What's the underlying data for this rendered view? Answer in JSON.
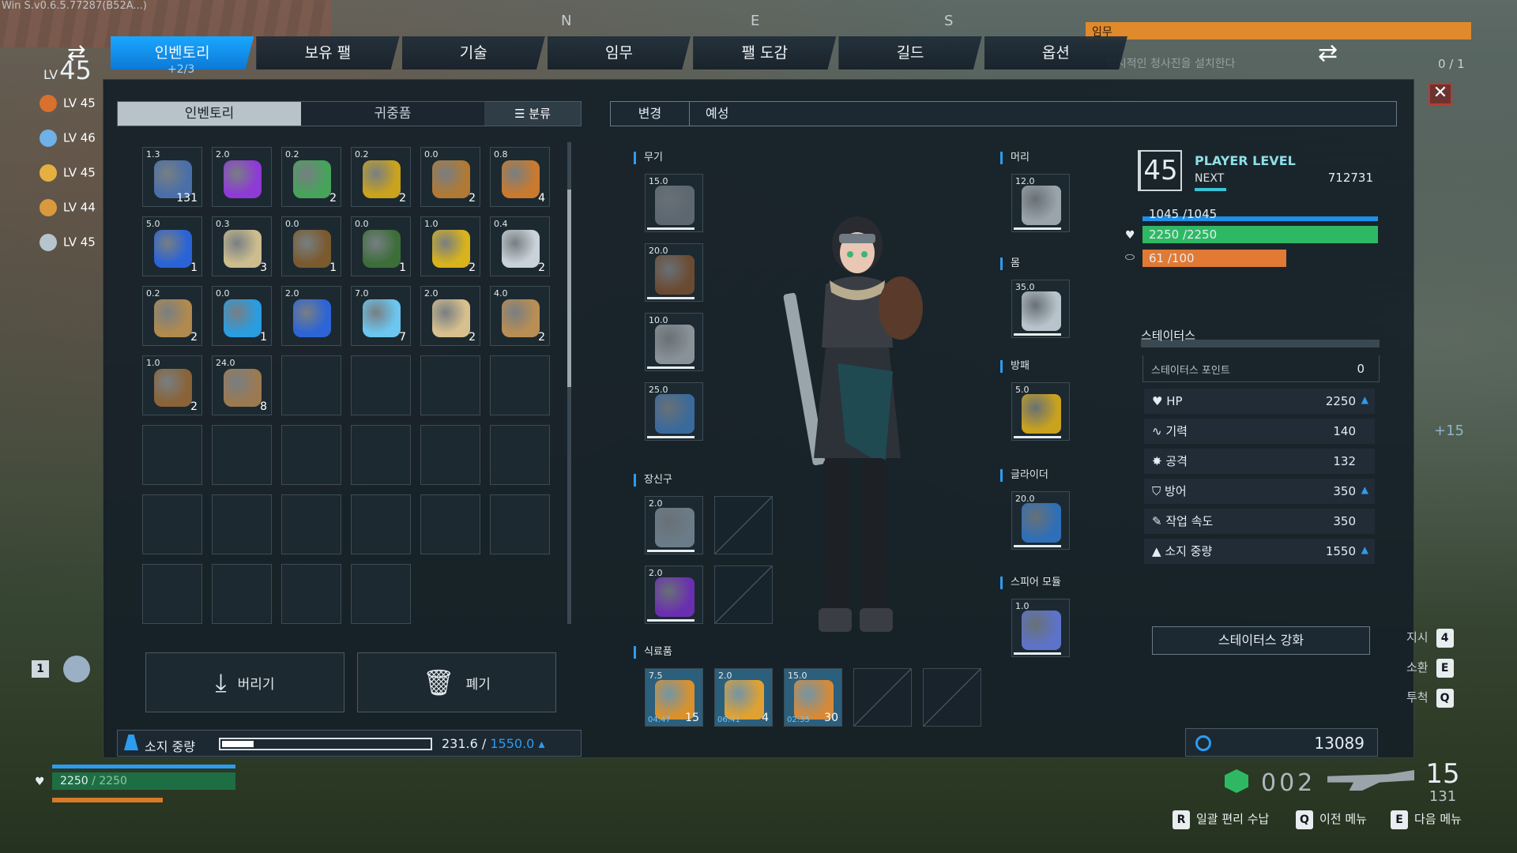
{
  "version_text": "Win S.v0.6.5.77287(B52A...)",
  "compass": [
    "N",
    "E",
    "S"
  ],
  "quest": {
    "label": "임무",
    "text": "임시적인 청사진을 설치한다",
    "count": "0 / 1"
  },
  "player": {
    "lv_prefix": "LV",
    "level": "45",
    "sub": "+2/3"
  },
  "party": [
    {
      "lv": "LV 45",
      "color": "#d9702e"
    },
    {
      "lv": "LV 46",
      "color": "#6fb1e8"
    },
    {
      "lv": "LV 45",
      "color": "#e6b040"
    },
    {
      "lv": "LV 44",
      "color": "#d99a3e"
    },
    {
      "lv": "LV 45",
      "color": "#b6c4ce"
    }
  ],
  "tabs": [
    "인벤토리",
    "보유 팰",
    "기술",
    "임무",
    "팰 도감",
    "길드",
    "옵션"
  ],
  "inventory": {
    "subtabs": [
      "인벤토리",
      "귀중품",
      "분류"
    ],
    "items": [
      {
        "w": "1.3",
        "q": "131",
        "icon": "arrow-bundle",
        "c": "#4a6fa8"
      },
      {
        "w": "2.0",
        "q": "",
        "icon": "whistle",
        "c": "#8e3ad6"
      },
      {
        "w": "0.2",
        "q": "2",
        "icon": "green-sphere",
        "c": "#47a35a"
      },
      {
        "w": "0.2",
        "q": "2",
        "icon": "gold-sphere",
        "c": "#c9a21e"
      },
      {
        "w": "0.0",
        "q": "2",
        "icon": "bullets",
        "c": "#b07a34"
      },
      {
        "w": "0.8",
        "q": "4",
        "icon": "telescope",
        "c": "#c97a2e"
      },
      {
        "w": "5.0",
        "q": "1",
        "icon": "blue-gem",
        "c": "#2a63d6"
      },
      {
        "w": "0.3",
        "q": "3",
        "icon": "scroll-map",
        "c": "#cdbd8e"
      },
      {
        "w": "0.0",
        "q": "1",
        "icon": "schematic",
        "c": "#7a5a2e"
      },
      {
        "w": "0.0",
        "q": "1",
        "icon": "green-book",
        "c": "#3d6e3a"
      },
      {
        "w": "1.0",
        "q": "2",
        "icon": "gold-ore",
        "c": "#d9b31c"
      },
      {
        "w": "0.4",
        "q": "2",
        "icon": "wool",
        "c": "#c9d2d8"
      },
      {
        "w": "0.2",
        "q": "2",
        "icon": "key",
        "c": "#b08a4e"
      },
      {
        "w": "0.0",
        "q": "1",
        "icon": "swirl-gem",
        "c": "#2a9ce0"
      },
      {
        "w": "2.0",
        "q": "",
        "icon": "blue-whistle",
        "c": "#2d64d6"
      },
      {
        "w": "7.0",
        "q": "7",
        "icon": "ice-crystal",
        "c": "#6cc6ee"
      },
      {
        "w": "2.0",
        "q": "2",
        "icon": "bone",
        "c": "#d8c08e"
      },
      {
        "w": "4.0",
        "q": "2",
        "icon": "wood-log",
        "c": "#b98e54"
      },
      {
        "w": "1.0",
        "q": "2",
        "icon": "fiber",
        "c": "#8a6338"
      },
      {
        "w": "24.0",
        "q": "8",
        "icon": "wood-pile",
        "c": "#9b7a52"
      }
    ],
    "empty_slots": 20,
    "drop_label": "버리기",
    "discard_label": "폐기",
    "weight_label": "소지 중량",
    "weight_value": "231.6 / ",
    "weight_max": "1550.0 ▴",
    "weight_ratio": 0.149
  },
  "equip": {
    "tab_change": "변경",
    "tab_preset": "예성",
    "sections": {
      "weapon": "무기",
      "head": "머리",
      "body": "몸",
      "shield": "방패",
      "accessory": "장신구",
      "glider": "글라이더",
      "sphere": "스피어 모듈",
      "food": "식료품"
    },
    "weapons": [
      {
        "w": "15.0",
        "c": "#5c6770"
      },
      {
        "w": "20.0",
        "c": "#6b4a32"
      },
      {
        "w": "10.0",
        "c": "#8a9299"
      },
      {
        "w": "25.0",
        "c": "#3a6a9c"
      }
    ],
    "head": {
      "w": "12.0",
      "c": "#9aa4ab"
    },
    "body": {
      "w": "35.0",
      "c": "#b8c4cc"
    },
    "shield": {
      "w": "5.0",
      "c": "#c9a21e"
    },
    "glider": {
      "w": "20.0",
      "c": "#2e6fb8"
    },
    "sphere": {
      "w": "1.0",
      "c": "#5d73c9"
    },
    "accessories": [
      {
        "w": "2.0",
        "c": "#6b7c88"
      },
      {
        "w": "2.0",
        "c": "#6a2fb0"
      }
    ],
    "food": [
      {
        "w": "7.5",
        "q": "15",
        "t": "04:47",
        "c": "#d9912e"
      },
      {
        "w": "2.0",
        "q": "4",
        "t": "06:41",
        "c": "#e0a132"
      },
      {
        "w": "15.0",
        "q": "30",
        "t": "02:35",
        "c": "#d58a3a"
      }
    ]
  },
  "status": {
    "level": "45",
    "player_level_label": "PLAYER LEVEL",
    "next_label": "NEXT",
    "next_value": "712731",
    "shield_text": "1045 /1045",
    "hp_text": "2250 /2250",
    "stamina_text": "61 /100",
    "stamina_ratio": 0.61,
    "section_title": "스테이터스",
    "points_label": "스테이터스 포인트",
    "points_value": "0",
    "stats": [
      {
        "icon": "heart-icon",
        "label": "HP",
        "value": "2250",
        "up": true
      },
      {
        "icon": "pulse-icon",
        "label": "기력",
        "value": "140",
        "up": false
      },
      {
        "icon": "attack-icon",
        "label": "공격",
        "value": "132",
        "up": false
      },
      {
        "icon": "shield-icon",
        "label": "방어",
        "value": "350",
        "up": true
      },
      {
        "icon": "work-icon",
        "label": "작업 속도",
        "value": "350",
        "up": false
      },
      {
        "icon": "weight-icon",
        "label": "소지 중량",
        "value": "1550",
        "up": true
      }
    ],
    "upgrade_label": "스테이터스 강화",
    "money": "13089"
  },
  "hud": {
    "hp_current": "2250",
    "hp_max": " / 2250",
    "counter": "002",
    "ammo": "15",
    "ammo_reserve": "131",
    "slot_key": "1",
    "side_keys": [
      {
        "label": "지시",
        "key": "4"
      },
      {
        "label": "소환",
        "key": "E"
      },
      {
        "label": "투척",
        "key": "Q"
      }
    ],
    "right_plus": "+15",
    "hints": [
      {
        "key": "R",
        "label": "일괄 편리 수납"
      },
      {
        "key": "Q",
        "label": "이전 메뉴"
      },
      {
        "key": "E",
        "label": "다음 메뉴"
      }
    ]
  }
}
